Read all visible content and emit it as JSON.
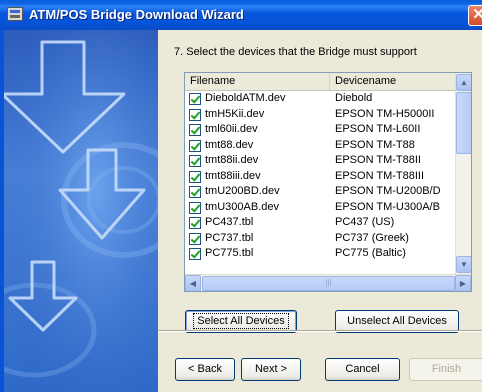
{
  "window": {
    "title": "ATM/POS Bridge Download Wizard",
    "close_glyph": "✕"
  },
  "step": {
    "text": "7.  Select the devices that the Bridge must support"
  },
  "list": {
    "columns": [
      "Filename",
      "Devicename"
    ],
    "rows": [
      {
        "filename": "DieboldATM.dev",
        "devicename": "Diebold",
        "checked": true
      },
      {
        "filename": "tmH5Kii.dev",
        "devicename": "EPSON TM-H5000II",
        "checked": true
      },
      {
        "filename": "tml60ii.dev",
        "devicename": "EPSON TM-L60II",
        "checked": true
      },
      {
        "filename": "tmt88.dev",
        "devicename": "EPSON TM-T88",
        "checked": true
      },
      {
        "filename": "tmt88ii.dev",
        "devicename": "EPSON TM-T88II",
        "checked": true
      },
      {
        "filename": "tmt88iii.dev",
        "devicename": "EPSON TM-T88III",
        "checked": true
      },
      {
        "filename": "tmU200BD.dev",
        "devicename": "EPSON TM-U200B/D",
        "checked": true
      },
      {
        "filename": "tmU300AB.dev",
        "devicename": "EPSON TM-U300A/B",
        "checked": true
      },
      {
        "filename": "PC437.tbl",
        "devicename": "PC437 (US)",
        "checked": true
      },
      {
        "filename": "PC737.tbl",
        "devicename": "PC737 (Greek)",
        "checked": true
      },
      {
        "filename": "PC775.tbl",
        "devicename": "PC775 (Baltic)",
        "checked": true
      }
    ]
  },
  "scroll": {
    "up": "▲",
    "down": "▼",
    "left": "◀",
    "right": "▶",
    "grip": "|||"
  },
  "buttons": {
    "select_all": "Select All Devices",
    "unselect_all": "Unselect All Devices",
    "back": "< Back",
    "next": "Next >",
    "cancel": "Cancel",
    "finish": "Finish"
  },
  "colors": {
    "titlebar": "#0a5fd8",
    "panel": "#3a74d0",
    "dialog_bg": "#ece9d8"
  },
  "icons": [
    "app-icon",
    "close-icon",
    "checkbox-icon",
    "arrow-down-graphic"
  ]
}
